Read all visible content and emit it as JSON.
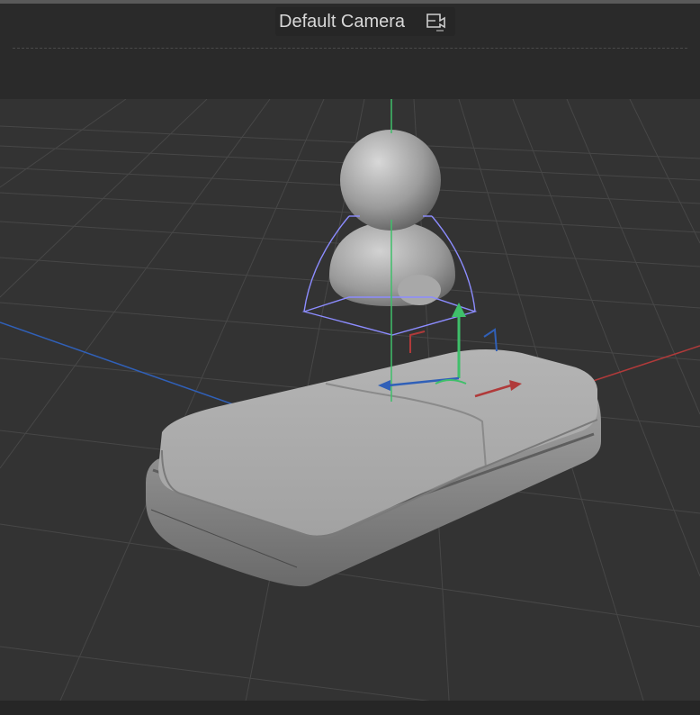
{
  "viewport": {
    "camera_label": "Default Camera",
    "camera_icon": "camera-switch-icon"
  },
  "colors": {
    "grid": "#474747",
    "x_axis": "#b03a3a",
    "y_axis": "#3fbf6a",
    "z_axis": "#3060b8",
    "selection": "#8c8cff",
    "model": "#b8b8b8"
  }
}
